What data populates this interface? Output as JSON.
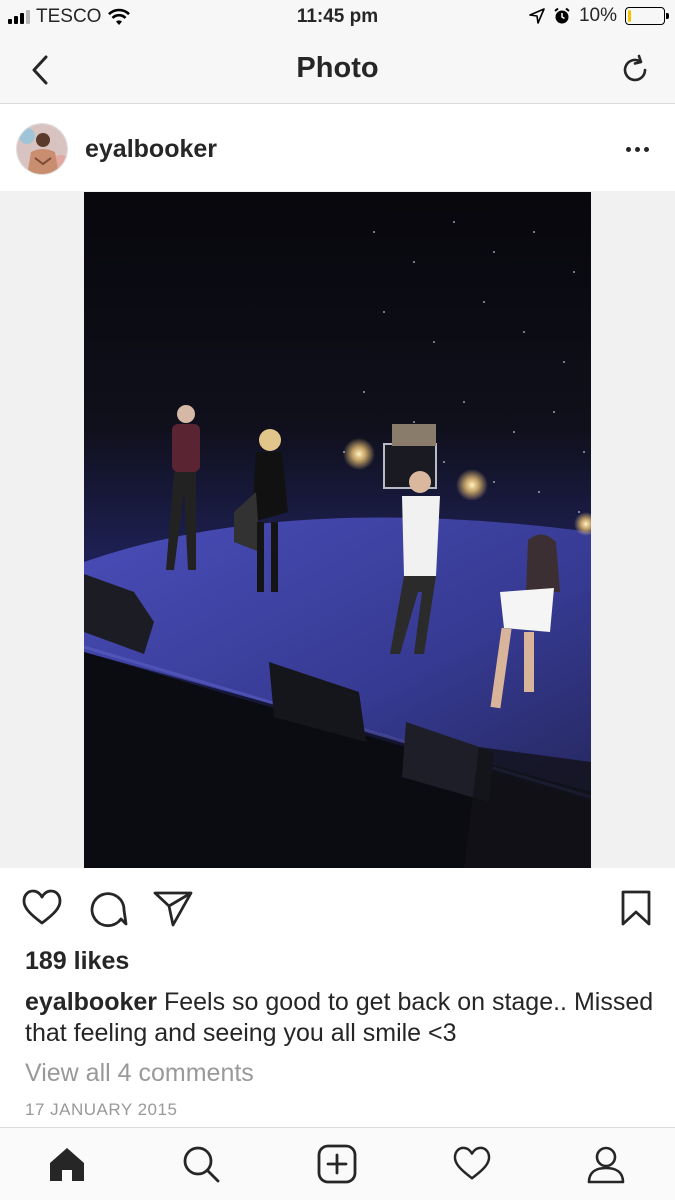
{
  "status_bar": {
    "carrier": "TESCO",
    "time": "11:45 pm",
    "battery": "10%",
    "battery_level": 0.1,
    "battery_color": "#f2c300"
  },
  "nav": {
    "title": "Photo",
    "back_icon": "chevron-left-icon",
    "refresh_icon": "refresh-icon"
  },
  "post": {
    "username": "eyalbooker",
    "more_icon": "more-horizontal-icon",
    "likes": "189 likes",
    "caption_user": "eyalbooker",
    "caption_text": " Feels so good to get back on stage.. Missed that feeling and seeing you all smile <3",
    "view_comments": "View all 4 comments",
    "date": "17 JANUARY 2015"
  },
  "actions": {
    "like_icon": "heart-icon",
    "comment_icon": "comment-icon",
    "share_icon": "send-icon",
    "save_icon": "bookmark-icon"
  },
  "tab_bar": {
    "items": [
      "home-icon",
      "search-icon",
      "add-post-icon",
      "activity-heart-icon",
      "profile-icon"
    ]
  },
  "colors": {
    "text": "#262626",
    "muted": "#999999",
    "bar_background": "#f7f7f7",
    "stage_blue": "#3b3f9e"
  }
}
